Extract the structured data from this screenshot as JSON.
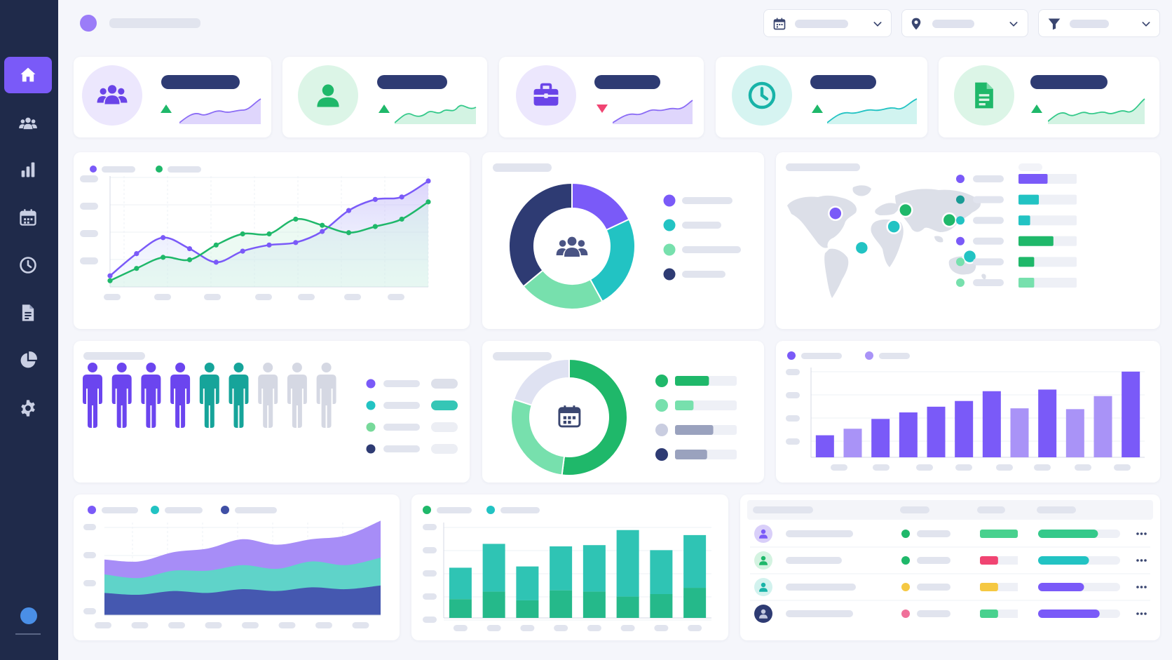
{
  "icons": {
    "nav": [
      "home-icon",
      "users-icon",
      "bar-chart-icon",
      "calendar-icon",
      "clock-icon",
      "document-icon",
      "pie-chart-icon",
      "gear-icon"
    ],
    "kpis": [
      "team-icon",
      "user-icon",
      "briefcase-icon",
      "clock-icon",
      "document-icon"
    ],
    "filters": [
      "calendar-icon",
      "location-pin-icon",
      "filter-icon"
    ]
  },
  "colors": {
    "sidebar": "#1f2a4a",
    "accent": "#7a5af8",
    "purple": "#7a5af8",
    "teal": "#22c3c3",
    "green": "#1fb86a",
    "navy": "#2e3b73",
    "pink": "#f04472",
    "yellow": "#f5c842"
  },
  "kpis": [
    {
      "trend": "up",
      "circle_bg": "#ece7fd",
      "icon_color": "#6a44e8",
      "spark_color": "#8b6cf5"
    },
    {
      "trend": "up",
      "circle_bg": "#dcf5e7",
      "icon_color": "#1fb86a",
      "spark_color": "#34c98a"
    },
    {
      "trend": "down",
      "circle_bg": "#ece7fd",
      "icon_color": "#6a44e8",
      "spark_color": "#8b6cf5"
    },
    {
      "trend": "up",
      "circle_bg": "#d6f4f1",
      "icon_color": "#18b3a8",
      "spark_color": "#22c3c3"
    },
    {
      "trend": "up",
      "circle_bg": "#dcf5e7",
      "icon_color": "#1fb86a",
      "spark_color": "#34c98a"
    }
  ],
  "people_chart": {
    "counts": {
      "purple": 4,
      "teal": 2,
      "gray": 3
    }
  },
  "chart_data": [
    {
      "type": "line",
      "series": [
        {
          "values": [
            0.9,
            2.7,
            4.0,
            3.1,
            2.0,
            2.9,
            3.4,
            3.6,
            4.5,
            6.2,
            7.1,
            7.3,
            8.6
          ]
        },
        {
          "values": [
            0.5,
            1.5,
            2.4,
            2.2,
            3.4,
            4.3,
            4.3,
            5.5,
            5.0,
            4.4,
            4.9,
            5.5,
            6.9
          ]
        }
      ],
      "series_colors": [
        "#7a5af8",
        "#1fb86a"
      ]
    },
    {
      "type": "pie",
      "donut": true,
      "values": [
        18,
        24,
        22,
        36
      ],
      "colors": [
        "#7a5af8",
        "#22c3c3",
        "#77e0ad",
        "#2e3b73"
      ]
    },
    {
      "type": "scatter",
      "subtype": "world-map-markers",
      "points": [
        {
          "lon": -95,
          "lat": 40,
          "color": "#7a5af8"
        },
        {
          "lon": -50,
          "lat": -12,
          "color": "#22c3c3"
        },
        {
          "lon": 5,
          "lat": 20,
          "color": "#22c3c3"
        },
        {
          "lon": 25,
          "lat": 45,
          "color": "#1fb86a"
        },
        {
          "lon": 100,
          "lat": 30,
          "color": "#1fb86a"
        },
        {
          "lon": 135,
          "lat": -25,
          "color": "#22c3c3"
        }
      ],
      "bars": [
        {
          "value": 0.5,
          "color": "#7a5af8"
        },
        {
          "value": 0.35,
          "color": "#22c3c3"
        },
        {
          "value": 0.2,
          "color": "#22c3c3"
        },
        {
          "value": 0.6,
          "color": "#1fb86a"
        },
        {
          "value": 0.27,
          "color": "#1fb86a"
        },
        {
          "value": 0.27,
          "color": "#77e0ad"
        }
      ],
      "dot_colors": [
        "#7a5af8",
        "#1a9b95",
        "#22c3c3",
        "#7a5af8",
        "#77e0ad",
        "#77e0ad"
      ]
    },
    {
      "type": "pie",
      "donut": true,
      "values": [
        52,
        28,
        20
      ],
      "colors": [
        "#1fb86a",
        "#77e0ad",
        "#dfe2f2"
      ],
      "legend_colors": [
        "#1fb86a",
        "#77e0ad",
        "#c9cde0",
        "#2e3b73"
      ],
      "legend_fill": [
        0.55,
        0.3,
        0.62,
        0.52
      ],
      "legend_fill_colors": [
        "#1fb86a",
        "#77e0ad",
        "#9aa2be",
        "#9aa2be"
      ]
    },
    {
      "type": "bar",
      "values": [
        2.7,
        3.5,
        4.7,
        5.5,
        6.2,
        6.9,
        8.1,
        6.0,
        8.3,
        5.9,
        7.5,
        10.5
      ],
      "colors": [
        "#7a5af8",
        "#a993f7",
        "#7a5af8",
        "#7a5af8",
        "#7a5af8",
        "#7a5af8",
        "#7a5af8",
        "#a993f7",
        "#7a5af8",
        "#a993f7",
        "#a993f7",
        "#7a5af8"
      ],
      "legend_colors": [
        "#7a5af8",
        "#a993f7"
      ]
    },
    {
      "type": "area",
      "stacked": true,
      "x_count": 9,
      "series": [
        {
          "values": [
            1.2,
            1.1,
            1.3,
            1.2,
            1.4,
            1.3,
            1.5,
            1.4,
            1.6
          ]
        },
        {
          "values": [
            1.0,
            0.9,
            1.1,
            1.2,
            1.3,
            1.2,
            1.4,
            1.3,
            1.5
          ]
        },
        {
          "values": [
            0.8,
            0.9,
            1.0,
            1.2,
            1.4,
            1.3,
            1.2,
            1.6,
            2.0
          ]
        }
      ],
      "series_colors": [
        "#4558b0",
        "#5fd3c9",
        "#a78df7"
      ]
    },
    {
      "type": "bar",
      "stacked": true,
      "series": [
        {
          "values": [
            2.5,
            3.8,
            2.7,
            3.5,
            3.7,
            5.3,
            3.5,
            4.2
          ]
        },
        {
          "values": [
            1.5,
            2.1,
            1.4,
            2.2,
            2.1,
            1.7,
            1.9,
            2.4
          ]
        }
      ],
      "series_colors": [
        "#2fc4b4",
        "#25b98a"
      ],
      "legend_colors": [
        "#1fb86a",
        "#22c3c3"
      ]
    },
    {
      "type": "table",
      "rows": [
        {
          "avatar_bg": "#d9cff9",
          "avatar_fg": "#7a5af8",
          "status": "#1fb86a",
          "tag": "#48d18e",
          "tag_fill": 1.0,
          "progress": 0.73,
          "progress_color": "#34c98a"
        },
        {
          "avatar_bg": "#d4f3e1",
          "avatar_fg": "#1fb86a",
          "status": "#1fb86a",
          "tag": "#f04472",
          "tag_fill": 0.48,
          "progress": 0.62,
          "progress_color": "#22c3c3"
        },
        {
          "avatar_bg": "#d2f2ee",
          "avatar_fg": "#18b3a8",
          "status": "#f5c842",
          "tag": "#f5c842",
          "tag_fill": 0.48,
          "progress": 0.56,
          "progress_color": "#7a5af8"
        },
        {
          "avatar_bg": "#2e3b73",
          "avatar_fg": "#c2c8e0",
          "status": "#f0709a",
          "tag": "#48d18e",
          "tag_fill": 0.48,
          "progress": 0.75,
          "progress_color": "#7a5af8"
        }
      ]
    }
  ]
}
